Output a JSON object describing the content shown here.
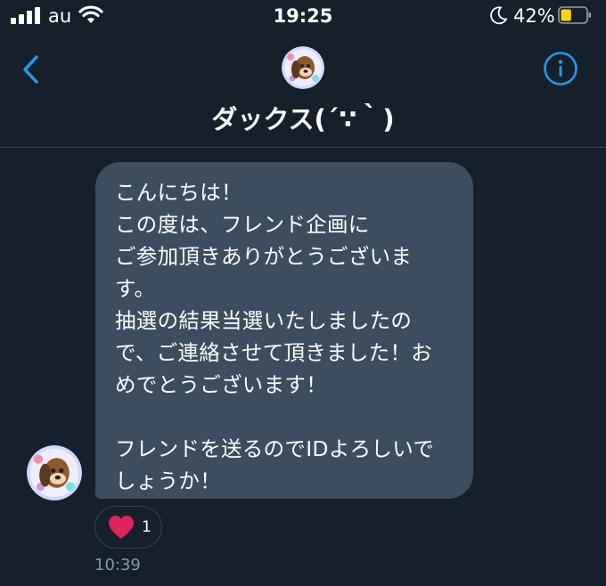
{
  "status_bar": {
    "carrier": "au",
    "time": "19:25",
    "battery_percent": "42%",
    "battery_level": 0.42
  },
  "header": {
    "title": "ダックス(´∵｀)",
    "back_icon": "chevron-left-icon",
    "info_icon": "info-circle-icon",
    "accent_color": "#1d9bf0"
  },
  "message": {
    "lines": [
      "こんにちは！",
      "この度は、フレンド企画に",
      "ご参加頂きありがとうございま",
      "す。",
      "抽選の結果当選いたしましたの",
      "で、ご連絡させて頂きました！お",
      "めでとうございます！",
      "",
      "フレンドを送るのでIDよろしいで",
      "しょうか！"
    ],
    "reaction": {
      "icon": "heart-icon",
      "count": "1",
      "color": "#e0245e"
    },
    "timestamp": "10:39"
  },
  "colors": {
    "background": "#15202b",
    "bubble": "#3b4d5e",
    "divider": "#38444d",
    "secondary_text": "#8899a6"
  }
}
